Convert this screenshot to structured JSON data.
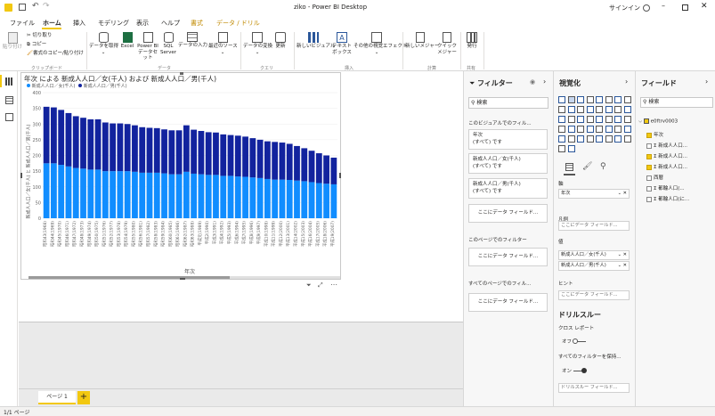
{
  "title": "ziko - Power BI Desktop",
  "signin": "サインイン",
  "menu": [
    "ファイル",
    "ホーム",
    "挿入",
    "モデリング",
    "表示",
    "ヘルプ",
    "書式",
    "データ / ドリル"
  ],
  "ribbon": {
    "clipboard": {
      "paste": "貼り付け",
      "cut": "切り取り",
      "copy": "コピー",
      "format_copy": "書式のコピー/貼り付け",
      "group": "クリップボード"
    },
    "data": {
      "get_data": "データを取得",
      "excel": "Excel",
      "pbi_dataset": "Power BI データセット",
      "sql": "SQL Server",
      "enter_data": "データの入力",
      "recent": "最近のソース",
      "group": "データ"
    },
    "query": {
      "transform": "データの変換",
      "refresh": "更新",
      "group": "クエリ"
    },
    "insert": {
      "new_visual": "新しいビジュアル",
      "textbox": "テキスト ボックス",
      "more_visuals": "その他の視覚エフェクト",
      "group": "挿入"
    },
    "calc": {
      "new_measure": "新しいメジャー",
      "quick_measure": "クイック メジャー",
      "group": "計算"
    },
    "share": {
      "publish": "発行",
      "group": "共有"
    }
  },
  "chart_data": {
    "type": "bar",
    "title": "年次 による 新成人人口／女(千人) および 新成人人口／男(千人)",
    "xlabel": "年次",
    "ylabel": "新成人人口／女(千人) と 新成人人口／男(千人)",
    "ylim": [
      0,
      400
    ],
    "yticks": [
      0,
      50,
      100,
      150,
      200,
      250,
      300,
      350,
      400
    ],
    "categories": [
      "昭和43(1968)",
      "昭和44(1969)",
      "昭和45(1970)",
      "昭和46(1971)",
      "昭和47(1972)",
      "昭和48(1973)",
      "昭和49(1974)",
      "昭和50(1975)",
      "昭和51(1976)",
      "昭和52(1977)",
      "昭和53(1978)",
      "昭和54(1979)",
      "昭和55(1980)",
      "昭和56(1981)",
      "昭和57(1982)",
      "昭和58(1983)",
      "昭和59(1984)",
      "昭和60(1985)",
      "昭和61(1986)",
      "昭和62(1987)",
      "昭和63(1988)",
      "平成元(1989)",
      "平成2(1990)",
      "平成3(1991)",
      "平成4(1992)",
      "平成5(1993)",
      "平成6(1994)",
      "平成7(1995)",
      "平成8(1996)",
      "平成9(1997)",
      "平成10(1998)",
      "平成11(1999)",
      "平成12(2000)",
      "平成13(2001)",
      "平成14(2002)",
      "平成15(2003)",
      "平成16(2004)",
      "平成17(2005)",
      "平成18(2006)",
      "平成19(2007)"
    ],
    "series": [
      {
        "name": "新成人人口／女(千人)",
        "color": "#118dff",
        "values": [
          175,
          175,
          170,
          165,
          160,
          158,
          155,
          155,
          150,
          150,
          150,
          150,
          148,
          145,
          145,
          145,
          143,
          140,
          140,
          148,
          142,
          140,
          138,
          138,
          135,
          135,
          133,
          132,
          130,
          128,
          125,
          123,
          123,
          122,
          120,
          118,
          115,
          112,
          110,
          108
        ]
      },
      {
        "name": "新成人人口／男(千人)",
        "color": "#12239e",
        "values": [
          180,
          178,
          175,
          170,
          165,
          162,
          160,
          160,
          155,
          152,
          152,
          150,
          148,
          145,
          143,
          142,
          140,
          140,
          140,
          148,
          140,
          138,
          136,
          135,
          132,
          130,
          130,
          128,
          125,
          122,
          120,
          120,
          118,
          115,
          110,
          105,
          100,
          95,
          90,
          85
        ]
      }
    ]
  },
  "filters": {
    "title": "フィルター",
    "search": "検索",
    "this_visual": "このビジュアルでのフィル...",
    "cards": [
      {
        "name": "年次",
        "value": "(すべて) です"
      },
      {
        "name": "新成人人口／女(千人)",
        "value": "(すべて) です"
      },
      {
        "name": "新成人人口／男(千人)",
        "value": "(すべて) です"
      }
    ],
    "add": "ここにデータ フィールド...",
    "this_page": "このページでのフィルター",
    "all_pages": "すべてのページでのフィル..."
  },
  "viz": {
    "title": "視覚化",
    "axis": "軸",
    "axis_field": "年次",
    "legend": "凡例",
    "value": "値",
    "value_fields": [
      "新成人人口／女(千人)",
      "新成人人口／男(千人)"
    ],
    "tooltip": "ヒント",
    "drop": "ここにデータ フィールド...",
    "drill": "ドリルスルー",
    "cross_report": "クロス レポート",
    "off": "オフ",
    "keep_filters": "すべてのフィルターを保持...",
    "on": "オン",
    "drill_drop": "ドリルスルー フィールド..."
  },
  "fields": {
    "title": "フィールド",
    "search": "検索",
    "table": "e0ftrv0003",
    "items": [
      {
        "name": "年次",
        "checked": true,
        "sigma": false
      },
      {
        "name": "新成人人口...",
        "checked": false,
        "sigma": true
      },
      {
        "name": "新成人人口...",
        "checked": true,
        "sigma": true
      },
      {
        "name": "新成人人口...",
        "checked": true,
        "sigma": true
      },
      {
        "name": "西暦",
        "checked": false,
        "sigma": false
      },
      {
        "name": "都輪人口(...",
        "checked": false,
        "sigma": true
      },
      {
        "name": "都輪人口(に...",
        "checked": false,
        "sigma": true
      }
    ]
  },
  "page_tab": "ページ 1",
  "status": "1/1 ページ"
}
